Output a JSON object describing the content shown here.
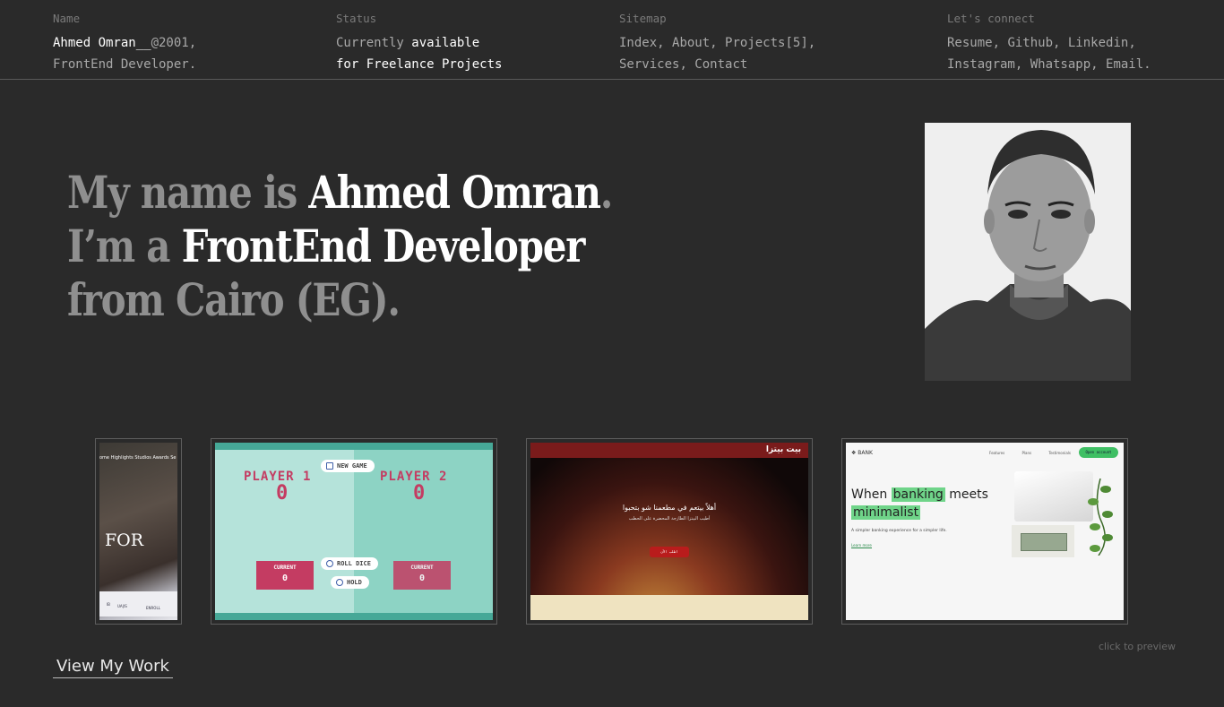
{
  "header": {
    "name": {
      "label": "Name",
      "line1_name": "Ahmed Omran__",
      "line1_rest": "@2001,",
      "line2": "FrontEnd Developer."
    },
    "status": {
      "label": "Status",
      "line1_a": "Currently ",
      "line1_b": "available",
      "line2": "for Freelance Projects"
    },
    "sitemap": {
      "label": "Sitemap",
      "items": [
        "Index",
        "About",
        "Projects[5]",
        "Services",
        "Contact"
      ]
    },
    "connect": {
      "label": "Let's connect",
      "items": [
        "Resume",
        "Github",
        "Linkedin",
        "Instagram",
        "Whatsapp",
        "Email"
      ]
    }
  },
  "hero": {
    "l1_a": "My name is ",
    "l1_b": "Ahmed Omran",
    "l1_c": ".",
    "l2_a": "I’m a ",
    "l2_b": "FrontEnd Developer",
    "l3": "from Cairo (EG)."
  },
  "projects": {
    "card1": {
      "text": "FOR"
    },
    "card2": {
      "player1": "PLAYER 1",
      "player2": "PLAYER 2",
      "score1": "0",
      "score2": "0",
      "new_game": "NEW GAME",
      "roll_dice": "ROLL DICE",
      "hold": "HOLD",
      "current": "CURRENT",
      "current1": "0",
      "current2": "0"
    },
    "card3": {
      "headline": "أهلاً بيتعم في مطعمنا شو بتحبوا",
      "sub": "أطيب البيتزا الطازجة المحضرة على الحطب",
      "button": "اطلب الآن",
      "logo": "بيت بيتزا"
    },
    "card4": {
      "logo": "BANK",
      "nav": "Features Plans Testimonials",
      "cta": "Open account",
      "h_a": "When ",
      "h_b": "banking",
      "h_c": " meets",
      "h_d": "minimalist",
      "sub": "A simpler banking experience for a simpler life.",
      "link": "Learn more"
    }
  },
  "footer": {
    "hint": "click to preview",
    "view_work": "View My Work"
  },
  "colors": {
    "background": "#2a2a2a",
    "text_dim": "#9a9a9a",
    "text_bright": "#ffffff",
    "accent_pink": "#c43c62",
    "accent_green": "#6fd489"
  }
}
